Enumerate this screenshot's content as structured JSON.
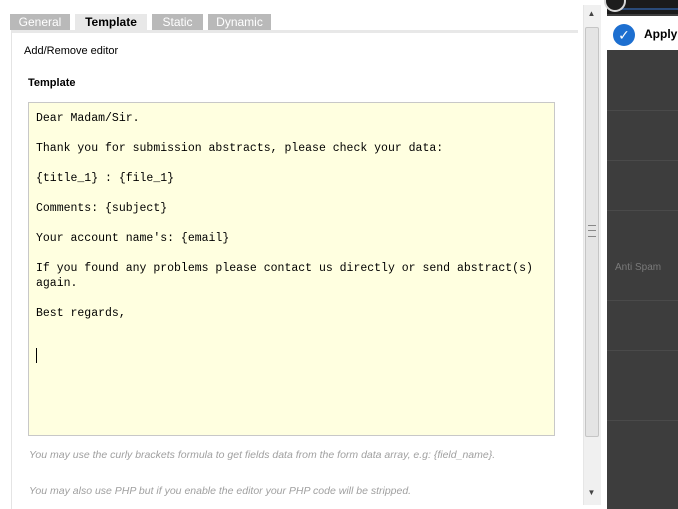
{
  "tabs": [
    {
      "label": "General"
    },
    {
      "label": "Template"
    },
    {
      "label": "Static"
    },
    {
      "label": "Dynamic"
    }
  ],
  "panel": {
    "add_remove_label": "Add/Remove editor",
    "section_title": "Template",
    "editor_lines": [
      "Dear Madam/Sir.",
      "Thank you for submission abstracts, please check your data:",
      "{title_1} : {file_1}",
      "Comments: {subject}",
      "Your account name's: {email}",
      "If you found any problems please contact us directly or send abstract(s)\nagain.",
      "Best regards,"
    ],
    "hint_curly": "You may use the curly brackets formula to get fields data from the form data array, e.g: {field_name}.",
    "hint_php": "You may also use PHP but if you enable the editor your PHP code will be stripped."
  },
  "sidebar": {
    "apply_label": "Apply",
    "anti_spam_label": "Anti Spam"
  },
  "icons": {
    "apply": "check-circle-icon",
    "scroll_up": "arrow-up-icon",
    "scroll_down": "arrow-down-icon"
  },
  "colors": {
    "editor_background": "#ffffe0",
    "tab_inactive": "#b9b9b9",
    "apply_icon": "#1d6fd0"
  }
}
